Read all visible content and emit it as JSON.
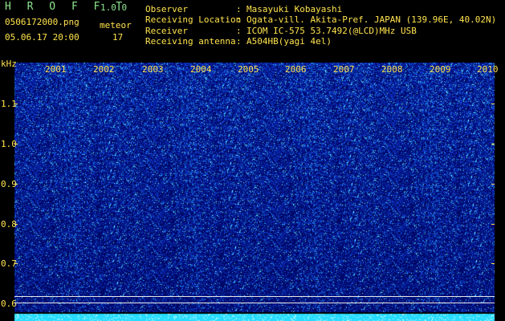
{
  "header": {
    "app_title": "H R O F F T",
    "app_version": "1.0.0",
    "file_name": "0506172000.png",
    "datetime": "05.06.17 20:00",
    "meteor_label": "meteor",
    "meteor_count": "17"
  },
  "info": [
    {
      "key": "Observer",
      "sep": ":",
      "value": "Masayuki Kobayashi"
    },
    {
      "key": "Receiving Location",
      "sep": ":",
      "value": "Ogata-vill. Akita-Pref. JAPAN (139.96E, 40.02N)"
    },
    {
      "key": "Receiver",
      "sep": ":",
      "value": "ICOM IC-575 53.7492(@LCD)MHz USB"
    },
    {
      "key": "Receiving antenna",
      "sep": ":",
      "value": "A504HB(yagi 4el)"
    }
  ],
  "axis": {
    "unit": "kHz",
    "y_labels": [
      "1.1",
      "1.0",
      "0.9",
      "0.8",
      "0.7",
      "0.6"
    ],
    "x_labels": [
      "2001",
      "2002",
      "2003",
      "2004",
      "2005",
      "2006",
      "2007",
      "2008",
      "2009",
      "2010"
    ]
  },
  "colors": {
    "background": "#000000",
    "header_green": "#8ee68e",
    "label_yellow": "#ffe34d",
    "spectrogram_base": "#0a1a9a",
    "noise_band": "#2fe6ff"
  }
}
